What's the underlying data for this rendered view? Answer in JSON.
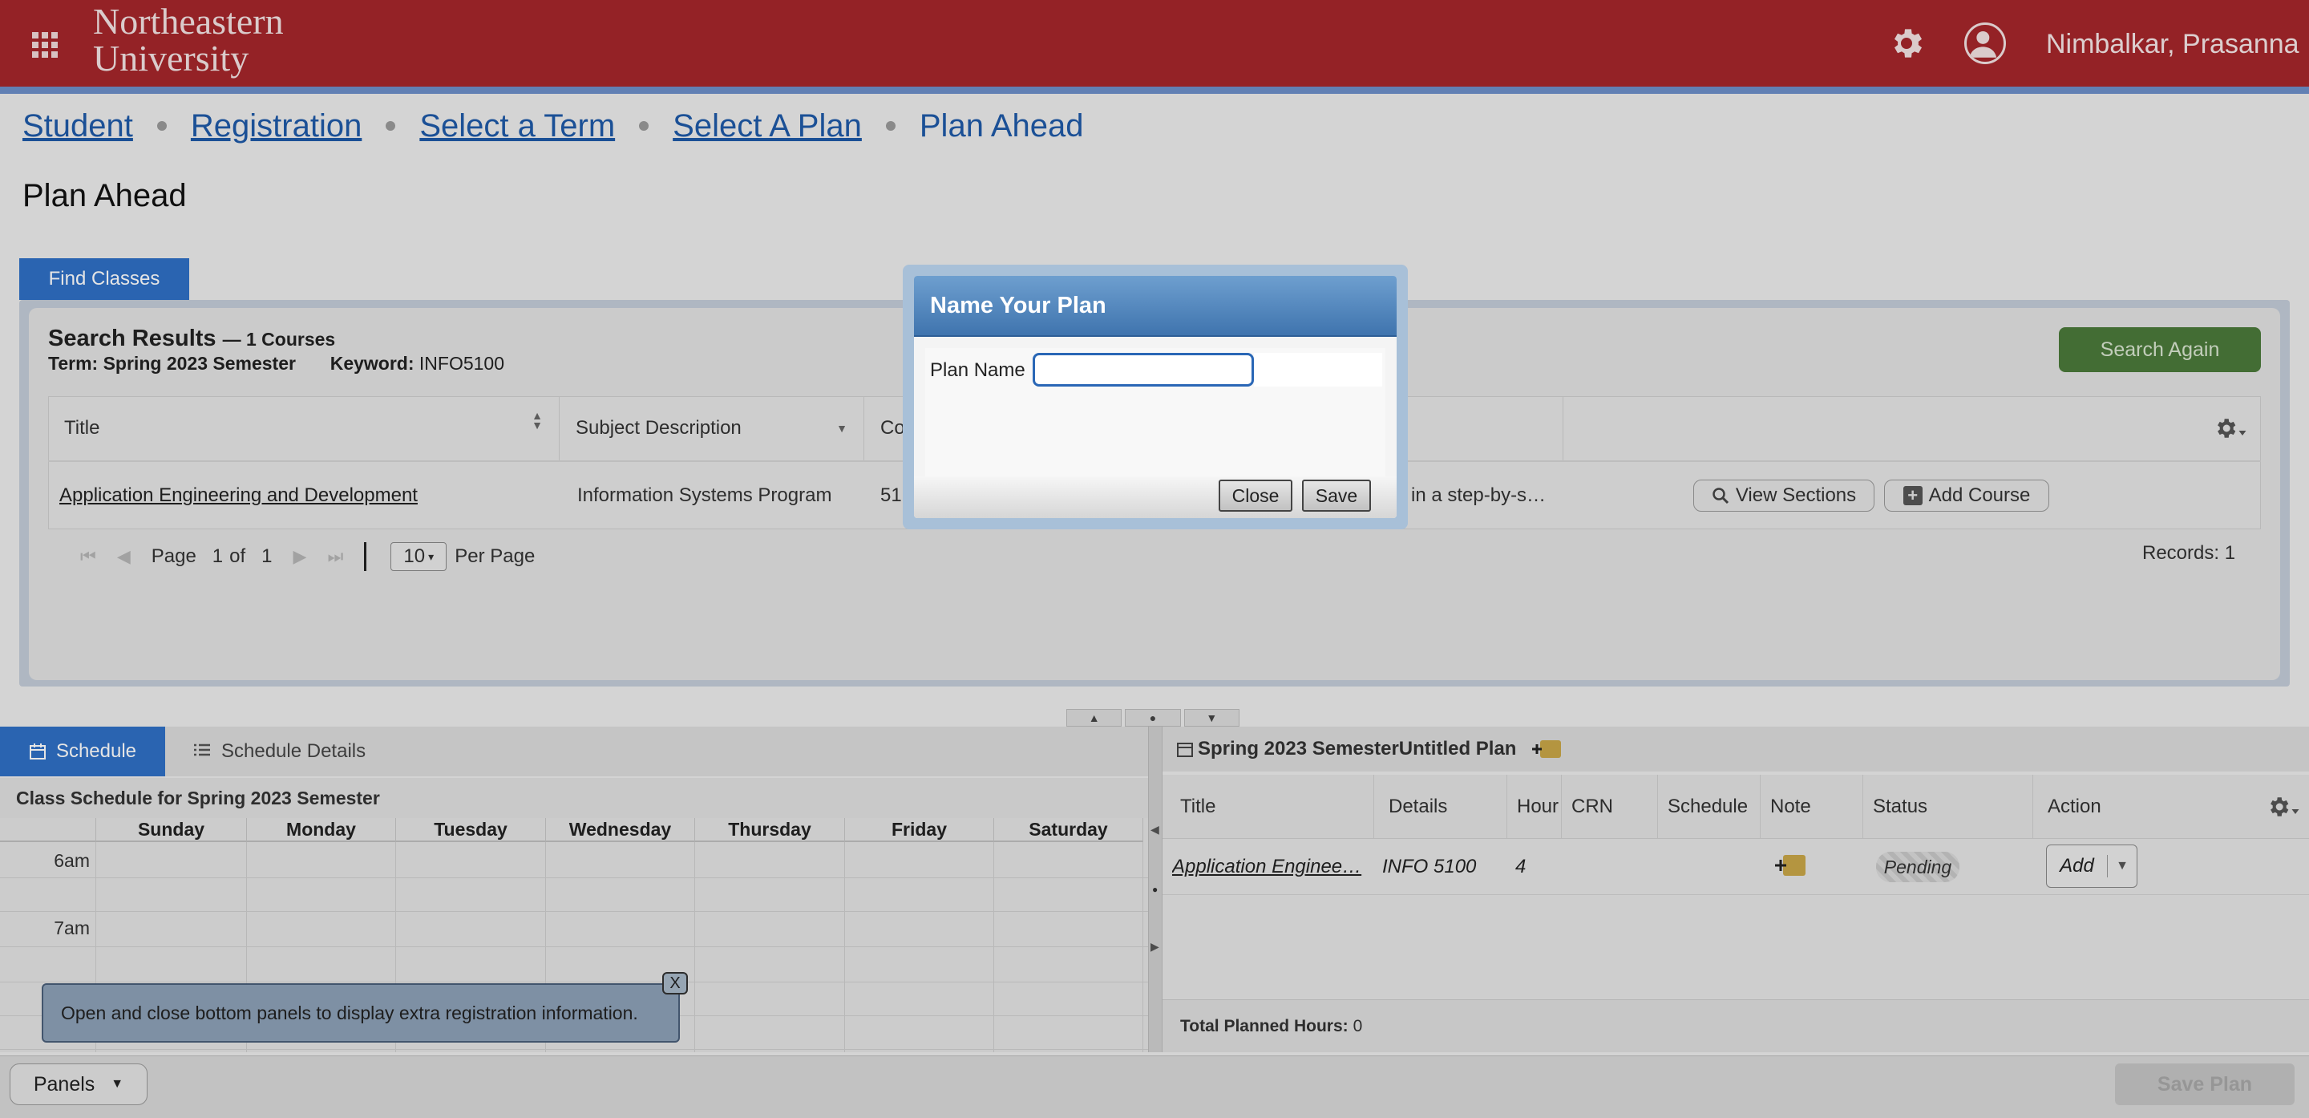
{
  "header": {
    "logo_line1": "Northeastern",
    "logo_line2": "University",
    "user_name": "Nimbalkar, Prasanna",
    "icons": {
      "apps": "grid-icon",
      "settings": "gear-icon",
      "user": "user-icon"
    }
  },
  "breadcrumb": [
    "Student",
    "Registration",
    "Select a Term",
    "Select A Plan",
    "Plan Ahead"
  ],
  "page_title": "Plan Ahead",
  "find_tab": "Find Classes",
  "search": {
    "title": "Search Results",
    "count_label": "— 1 Courses",
    "term_label": "Term:",
    "term_value": "Spring 2023 Semester",
    "keyword_label": "Keyword:",
    "keyword_value": "INFO5100",
    "search_again": "Search Again",
    "columns": [
      "Title",
      "Subject Description",
      "Co"
    ],
    "row": {
      "title": "Application Engineering and Development",
      "subject": "Information Systems Program",
      "course_num": "51",
      "desc_snippet": "in a step-by-s…",
      "view_sections": "View Sections",
      "add_course": "Add Course"
    },
    "pager": {
      "page_label": "Page",
      "page_value": "1",
      "of_label": "of",
      "total_pages": "1",
      "per_page_value": "10",
      "per_page_label": "Per Page",
      "records": "Records: 1"
    }
  },
  "schedule": {
    "tab_schedule": "Schedule",
    "tab_details": "Schedule Details",
    "title": "Class Schedule for Spring 2023 Semester",
    "days": [
      "Sunday",
      "Monday",
      "Tuesday",
      "Wednesday",
      "Thursday",
      "Friday",
      "Saturday"
    ],
    "times": [
      "6am",
      "7am"
    ],
    "tooltip": "Open and close bottom panels to display extra registration information.",
    "tooltip_close": "X"
  },
  "plan": {
    "header": "Spring 2023 SemesterUntitled Plan",
    "columns": [
      "Title",
      "Details",
      "Hour",
      "CRN",
      "Schedule",
      "Note",
      "Status",
      "Action"
    ],
    "row": {
      "title": "Application Enginee…",
      "details": "INFO 5100",
      "hours": "4",
      "status": "Pending",
      "action": "Add"
    },
    "total_label": "Total Planned Hours:",
    "total_value": "0"
  },
  "footer": {
    "panels": "Panels",
    "save_plan": "Save Plan"
  },
  "modal": {
    "title": "Name Your Plan",
    "plan_name_label": "Plan Name",
    "plan_name_value": "",
    "close": "Close",
    "save": "Save"
  },
  "colors": {
    "header_bg": "#a5262b",
    "accent_blue": "#2f70c6",
    "search_again_green": "#4b7a3a"
  }
}
